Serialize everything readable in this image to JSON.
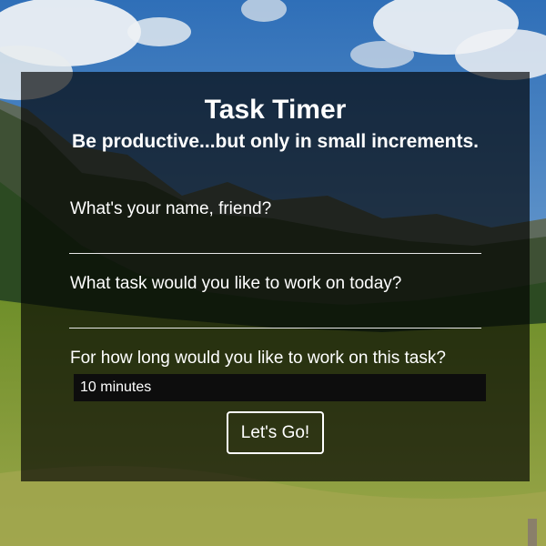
{
  "app": {
    "title": "Task Timer",
    "subtitle": "Be productive...but only in small increments."
  },
  "form": {
    "name_label": "What's your name, friend?",
    "name_value": "",
    "task_label": "What task would you like to work on today?",
    "task_value": "",
    "duration_label": "For how long would you like to work on this task?",
    "duration_selected": "10 minutes",
    "submit_label": "Let's Go!"
  },
  "colors": {
    "panel_background": "rgba(0,0,0,0.66)",
    "text": "#ffffff",
    "input_underline": "#e6e6e6",
    "select_background": "#0d0d0d"
  }
}
